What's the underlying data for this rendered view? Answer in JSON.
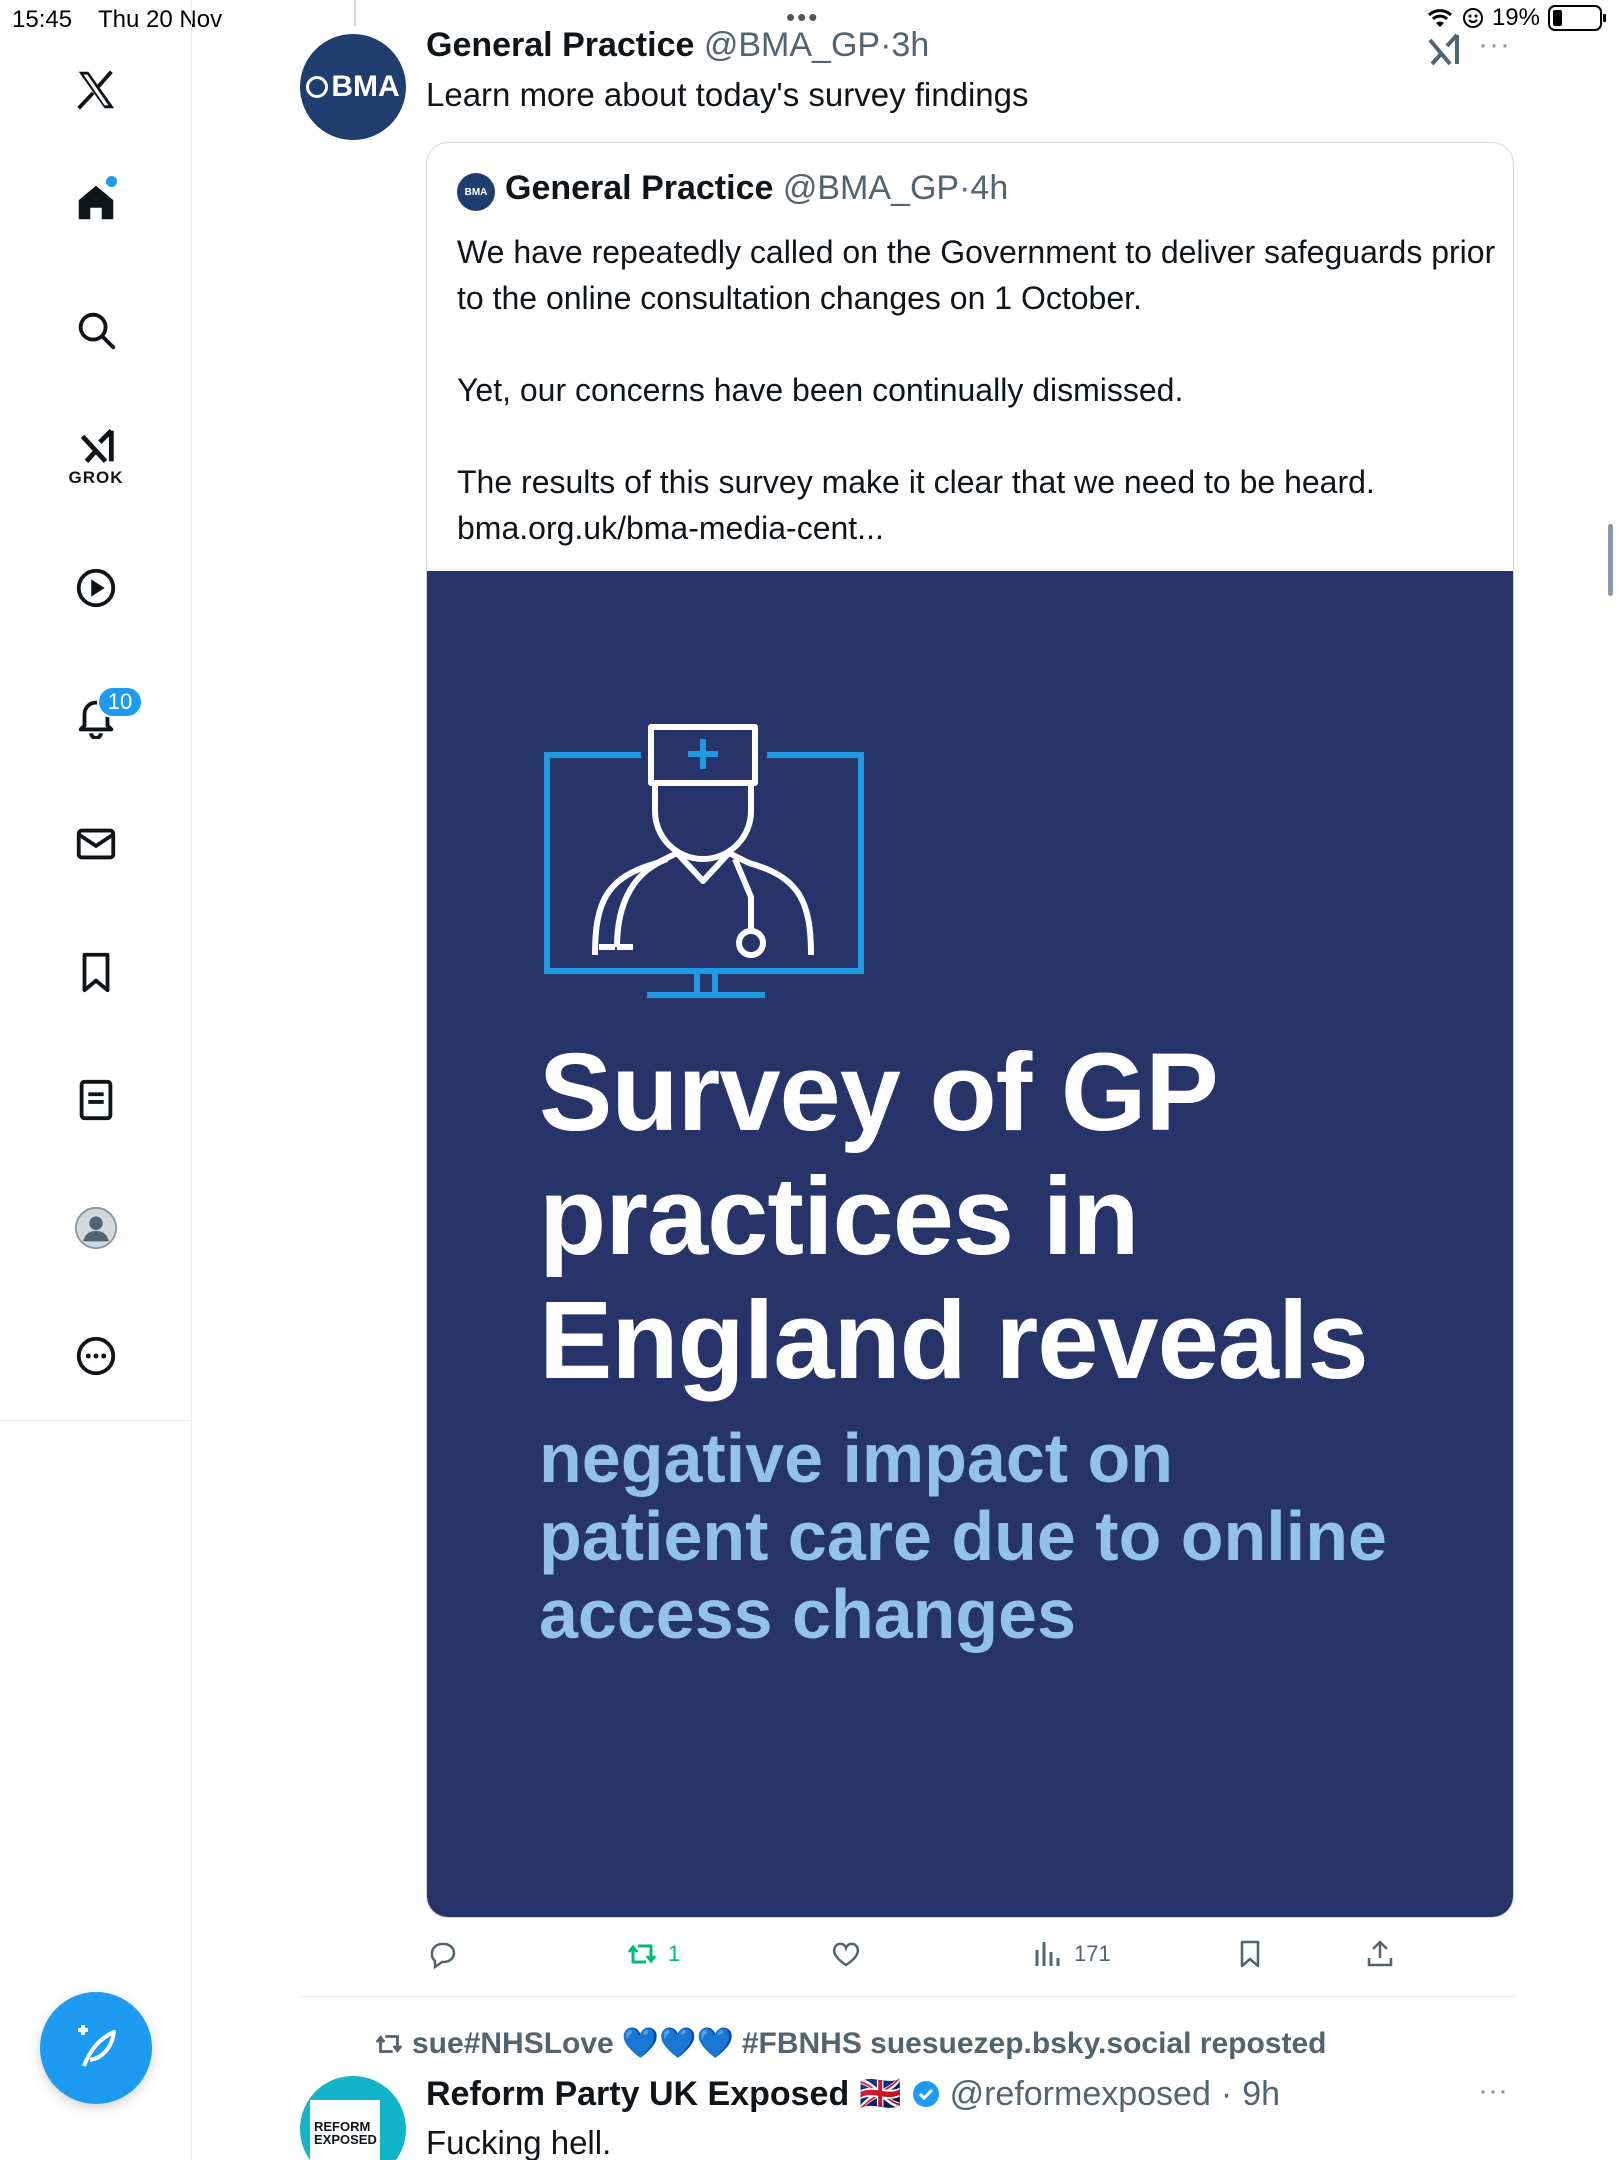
{
  "status_bar": {
    "time": "15:45",
    "date": "Thu 20 Nov",
    "battery": "19%",
    "multitask_dots": "•••"
  },
  "sidebar": {
    "notifications_count": "10",
    "grok_label": "GROK"
  },
  "tweet": {
    "author_name": "General Practice",
    "author_handle": "@BMA_GP",
    "time": "3h",
    "avatar_text": "BMA",
    "text": "Learn more about today's survey findings",
    "more": "···",
    "quote": {
      "author_name": "General Practice",
      "author_handle": "@BMA_GP",
      "time": "4h",
      "avatar_text": "BMA",
      "paragraphs": [
        "We have repeatedly called on the Government to deliver safeguards prior to the online consultation changes on 1 October.",
        "Yet, our concerns have been continually dismissed.",
        "The results of this survey make it clear that we need to be heard."
      ],
      "link": "bma.org.uk/bma-media-cent...",
      "image": {
        "title_lines": [
          "Survey of GP",
          "practices in",
          "England reveals"
        ],
        "subtitle_lines": [
          "negative impact on",
          "patient care due to online",
          "access changes"
        ]
      }
    },
    "actions": {
      "retweets": "1",
      "views": "171"
    }
  },
  "next_tweet": {
    "repost_by_prefix": "sue#NHSLove",
    "hearts": "💙💙💙",
    "repost_by_suffix": "#FBNHS suesuezep.bsky.social reposted",
    "author_name": "Reform Party UK Exposed",
    "flag": "🇬🇧",
    "author_handle": "@reformexposed",
    "time": "9h",
    "text": "Fucking hell.",
    "avatar_text": "REFORM EXPOSED",
    "more": "···"
  },
  "colors": {
    "accent": "#1d9bf0",
    "retweet": "#00ba7c",
    "image_bg": "#26346a",
    "image_subtitle": "#92c2ea",
    "bma_navy": "#1f3d6e"
  },
  "icons": [
    "x-logo-icon",
    "home-icon",
    "search-icon",
    "grok-icon",
    "video-icon",
    "bell-icon",
    "mail-icon",
    "bookmark-icon",
    "list-icon",
    "profile-icon",
    "more-circle-icon",
    "compose-icon",
    "reply-icon",
    "retweet-icon",
    "like-icon",
    "views-icon",
    "share-icon"
  ]
}
